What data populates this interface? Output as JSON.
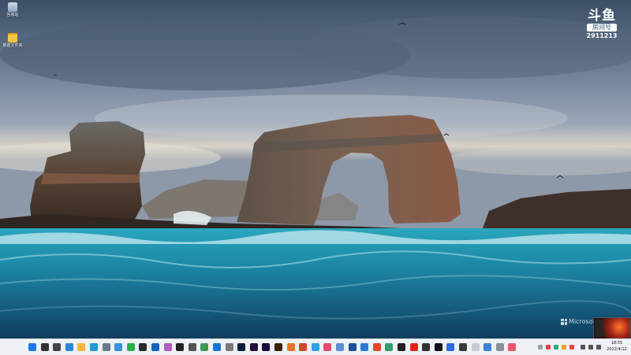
{
  "desktop": {
    "icons": [
      {
        "name": "recycle-bin-icon",
        "label": "回收站"
      },
      {
        "name": "folder-icon",
        "label": "新建文件夹"
      }
    ],
    "stream_logo": {
      "brand": "斗鱼",
      "room_label": "房间号",
      "room_number": "2911213"
    },
    "watermark": "Microsoft"
  },
  "taskbar": {
    "apps": [
      {
        "name": "start-icon",
        "color": "#1e7ae6"
      },
      {
        "name": "search-icon",
        "color": "#333333"
      },
      {
        "name": "task-view-icon",
        "color": "#444444"
      },
      {
        "name": "widgets-icon",
        "color": "#2b88d8"
      },
      {
        "name": "file-explorer-icon",
        "color": "#f2b63c"
      },
      {
        "name": "edge-icon",
        "color": "#1f9ad6"
      },
      {
        "name": "settings-icon",
        "color": "#6b7a8f"
      },
      {
        "name": "photos-icon",
        "color": "#3a8ee6"
      },
      {
        "name": "wechat-icon",
        "color": "#2ab04a"
      },
      {
        "name": "security-icon",
        "color": "#2a2a2a"
      },
      {
        "name": "mail-icon",
        "color": "#1565c0"
      },
      {
        "name": "translator-icon",
        "color": "#b05cc0"
      },
      {
        "name": "qq-icon",
        "color": "#222222"
      },
      {
        "name": "terminal-icon",
        "color": "#555555"
      },
      {
        "name": "notepad-icon",
        "color": "#3f9a5a"
      },
      {
        "name": "store-icon",
        "color": "#1976d2"
      },
      {
        "name": "app-icon",
        "color": "#7a7a7a"
      },
      {
        "name": "photoshop-icon",
        "color": "#0a1f3d"
      },
      {
        "name": "premiere-icon",
        "color": "#2a0a3d"
      },
      {
        "name": "after-effects-icon",
        "color": "#1a0a3d"
      },
      {
        "name": "illustrator-icon",
        "color": "#3d1f00"
      },
      {
        "name": "media-icon",
        "color": "#e8742a"
      },
      {
        "name": "office-icon",
        "color": "#d24726"
      },
      {
        "name": "browser-icon",
        "color": "#2ba3e0"
      },
      {
        "name": "app-red-icon",
        "color": "#e84c6c"
      },
      {
        "name": "app-blue-icon",
        "color": "#5b8fd6"
      },
      {
        "name": "app-navy-icon",
        "color": "#1a4f9c"
      },
      {
        "name": "network-icon",
        "color": "#2a7ad6"
      },
      {
        "name": "chrome-icon",
        "color": "#e0492e"
      },
      {
        "name": "app-green-icon",
        "color": "#2f9e6a"
      },
      {
        "name": "github-icon",
        "color": "#222222"
      },
      {
        "name": "youtube-icon",
        "color": "#e62117"
      },
      {
        "name": "app-dark-icon",
        "color": "#333333"
      },
      {
        "name": "capcut-icon",
        "color": "#111111"
      },
      {
        "name": "app-blue2-icon",
        "color": "#2a6ae0"
      },
      {
        "name": "obs-icon",
        "color": "#3a3a3a"
      },
      {
        "name": "app-light-icon",
        "color": "#c7ccd3"
      },
      {
        "name": "calendar-icon",
        "color": "#3c82d6"
      },
      {
        "name": "app-grey-icon",
        "color": "#8a8f96"
      },
      {
        "name": "app-pink-icon",
        "color": "#e85a6a"
      }
    ],
    "tray": {
      "time": "18:55",
      "date": "2022/4/12"
    }
  }
}
